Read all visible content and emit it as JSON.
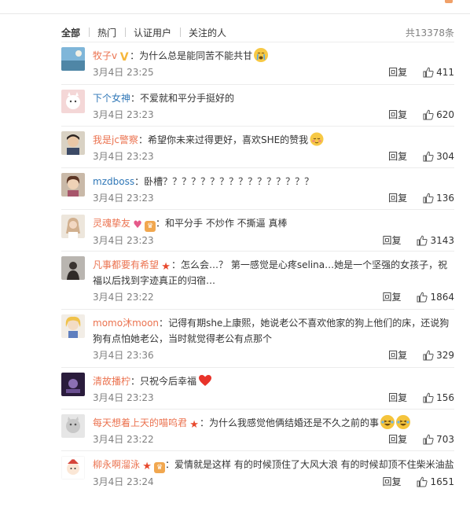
{
  "tabs": [
    "全部",
    "热门",
    "认证用户",
    "关注的人"
  ],
  "total": "共13378条",
  "reply_label": "回复",
  "comments": [
    {
      "user": "牧子v",
      "text": "为什么总是能同苦不能共甘",
      "time": "3月4日 23:25",
      "likes": "411"
    },
    {
      "user": "下个女神",
      "text": "不爱就和平分手挺好的",
      "time": "3月4日 23:23",
      "likes": "620"
    },
    {
      "user": "我是jc警察",
      "text": "希望你未来过得更好，喜欢SHE的赞我",
      "time": "3月4日 23:23",
      "likes": "304"
    },
    {
      "user": "mzdboss",
      "text": "卧槽？？？？？？？？？？？？？？？？",
      "time": "3月4日 23:23",
      "likes": "136"
    },
    {
      "user": "灵魂挚友",
      "text": "和平分手  不炒作 不撕逼 真棒",
      "time": "3月4日 23:23",
      "likes": "3143"
    },
    {
      "user": "凡事都要有希望",
      "text": "怎么会…？ 第一感觉是心疼selina…她是一个坚强的女孩子，祝福以后找到字迹真正的归宿…",
      "time": "3月4日 23:22",
      "likes": "1864"
    },
    {
      "user": "momo沐moon",
      "text": "记得有期she上康熙，她说老公不喜欢他家的狗上他们的床，还说狗狗有点怕她老公，当时就觉得老公有点那个",
      "time": "3月4日 23:36",
      "likes": "329"
    },
    {
      "user": "清故播柠",
      "text": "只祝今后幸福",
      "time": "3月4日 23:23",
      "likes": "156"
    },
    {
      "user": "每天想着上天的喵呜君",
      "text": "为什么我感觉他俩结婚还是不久之前的事",
      "time": "3月4日 23:22",
      "likes": "703"
    },
    {
      "user": "柳永啊溜泳",
      "text": "爱情就是这样 有的时候顶住了大风大浪 有的时候却顶不住柴米油盐",
      "time": "3月4日 23:24",
      "likes": "1651"
    }
  ]
}
